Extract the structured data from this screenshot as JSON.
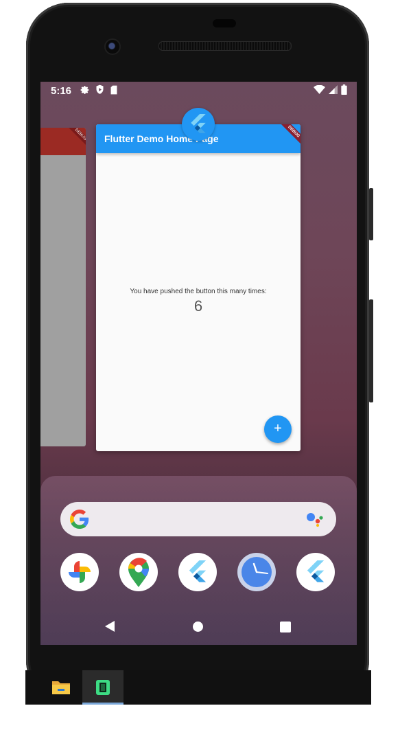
{
  "status_bar": {
    "time": "5:16",
    "left_icons": [
      "settings-icon",
      "shield-play-icon",
      "sd-card-icon"
    ],
    "right_icons": [
      "wifi-icon",
      "signal-icon",
      "battery-icon"
    ]
  },
  "recents": {
    "main_card": {
      "app_bar_title": "Flutter Demo Home Page",
      "debug_banner": "DEBUG",
      "counter_label": "You have pushed the button this many times:",
      "counter_value": "6",
      "fab_label": "+"
    },
    "left_card": {
      "debug_banner": "DEBUG"
    }
  },
  "dock": {
    "search_icons": [
      "google-g-icon",
      "assistant-icon"
    ],
    "apps": [
      {
        "name": "photos",
        "icon": "pinwheel-icon"
      },
      {
        "name": "maps",
        "icon": "map-pin-icon"
      },
      {
        "name": "flutter-app-1",
        "icon": "flutter-icon"
      },
      {
        "name": "clock",
        "icon": "clock-icon"
      },
      {
        "name": "flutter-app-2",
        "icon": "flutter-icon"
      }
    ]
  },
  "nav": {
    "back": "back-icon",
    "home": "home-icon",
    "recents": "recents-icon"
  },
  "taskbar": {
    "items": [
      "file-explorer-icon",
      "emulator-icon"
    ],
    "accent": "#7aa7d8"
  },
  "colors": {
    "flutter_blue": "#2196f3",
    "red_app_bar": "#9b2a23"
  }
}
